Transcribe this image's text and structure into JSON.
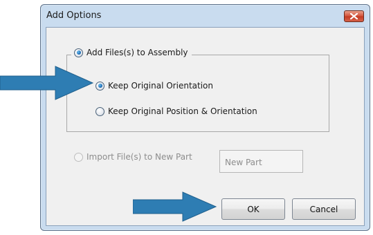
{
  "window": {
    "title": "Add Options"
  },
  "group": {
    "add_files_label": "Add Files(s) to Assembly",
    "keep_orientation_label": "Keep Original Orientation",
    "keep_position_label": "Keep Original Position & Orientation"
  },
  "import": {
    "label": "Import File(s) to New Part",
    "new_part_value": "New Part"
  },
  "buttons": {
    "ok": "OK",
    "cancel": "Cancel"
  },
  "colors": {
    "arrow": "#2e7db3",
    "window_frame": "#c9dcef",
    "client": "#f0f0f0",
    "close_button": "#c9432b"
  },
  "icons": {
    "close": "close-x-icon",
    "annotation": "blue-right-arrow"
  },
  "state": {
    "add_files_checked": true,
    "keep_orientation_checked": true,
    "keep_position_checked": false,
    "import_enabled": false
  }
}
